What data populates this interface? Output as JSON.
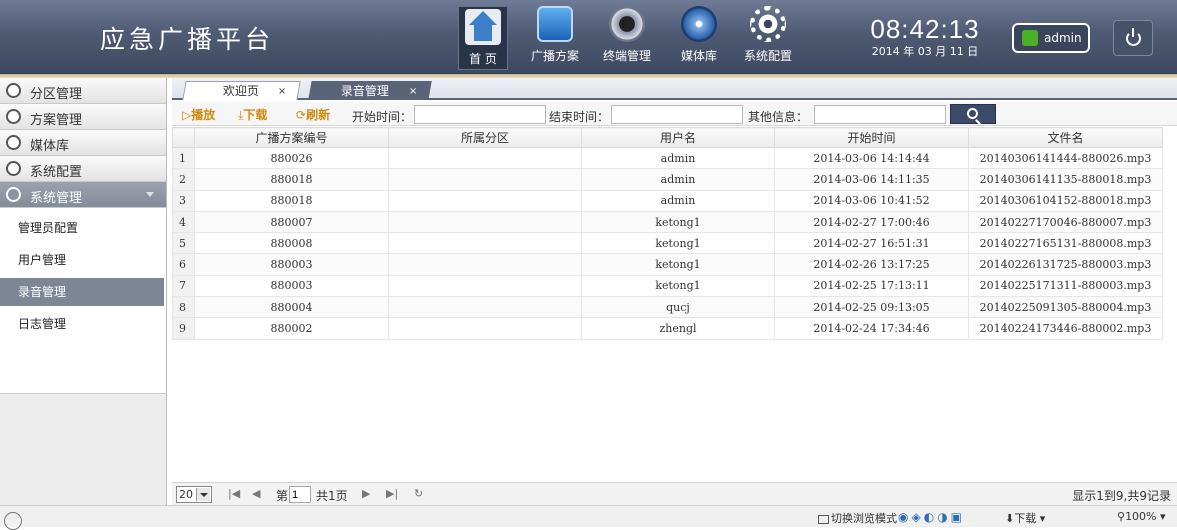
{
  "header": {
    "title": "应急广播平台",
    "nav": [
      {
        "label": "首 页",
        "icon": "home-icon"
      },
      {
        "label": "广播方案",
        "icon": "broadcast-plan-icon"
      },
      {
        "label": "终端管理",
        "icon": "terminal-icon"
      },
      {
        "label": "媒体库",
        "icon": "media-icon"
      },
      {
        "label": "系统配置",
        "icon": "settings-gear-icon"
      }
    ],
    "time": "08:42:13",
    "date": "2014 年 03 月 11 日",
    "user": "admin"
  },
  "sidebar": {
    "groups": [
      {
        "label": "分区管理",
        "icon": "location-pin-icon"
      },
      {
        "label": "方案管理",
        "icon": "list-icon"
      },
      {
        "label": "媒体库",
        "icon": "media-icon"
      },
      {
        "label": "系统配置",
        "icon": "gear-icon"
      },
      {
        "label": "系统管理",
        "icon": "eye-icon"
      }
    ],
    "sub_items": [
      "管理员配置",
      "用户管理",
      "录音管理",
      "日志管理"
    ]
  },
  "tabs": [
    {
      "label": "欢迎页",
      "close": "×"
    },
    {
      "label": "录音管理",
      "close": "×"
    }
  ],
  "toolbar": {
    "play": "播放",
    "download": "下载",
    "refresh": "刷新",
    "start_label": "开始时间：",
    "end_label": "结束时间：",
    "other_label": "其他信息："
  },
  "table": {
    "columns": [
      "广播方案编号",
      "所属分区",
      "用户名",
      "开始时间",
      "文件名"
    ],
    "rows": [
      [
        "1",
        "880026",
        "",
        "admin",
        "2014-03-06 14:14:44",
        "20140306141444-880026.mp3"
      ],
      [
        "2",
        "880018",
        "",
        "admin",
        "2014-03-06 14:11:35",
        "20140306141135-880018.mp3"
      ],
      [
        "3",
        "880018",
        "",
        "admin",
        "2014-03-06 10:41:52",
        "20140306104152-880018.mp3"
      ],
      [
        "4",
        "880007",
        "",
        "ketong1",
        "2014-02-27 17:00:46",
        "20140227170046-880007.mp3"
      ],
      [
        "5",
        "880008",
        "",
        "ketong1",
        "2014-02-27 16:51:31",
        "20140227165131-880008.mp3"
      ],
      [
        "6",
        "880003",
        "",
        "ketong1",
        "2014-02-26 13:17:25",
        "20140226131725-880003.mp3"
      ],
      [
        "7",
        "880003",
        "",
        "ketong1",
        "2014-02-25 17:13:11",
        "20140225171311-880003.mp3"
      ],
      [
        "8",
        "880004",
        "",
        "qucj",
        "2014-02-25 09:13:05",
        "20140225091305-880004.mp3"
      ],
      [
        "9",
        "880002",
        "",
        "zhengl",
        "2014-02-24 17:34:46",
        "20140224173446-880002.mp3"
      ]
    ]
  },
  "pager": {
    "page_size": "20",
    "page_prefix": "第",
    "page_value": "1",
    "page_total": "共1页",
    "info": "显示1到9,共9记录"
  },
  "statusbar": {
    "mode": "切换浏览模式",
    "download": "下载",
    "zoom": "100%"
  }
}
